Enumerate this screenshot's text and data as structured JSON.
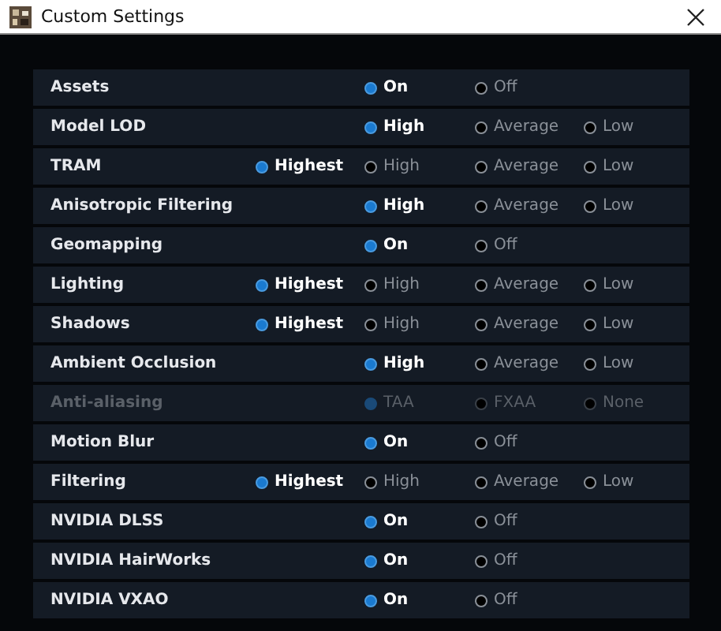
{
  "window": {
    "title": "Custom Settings"
  },
  "settings": [
    {
      "label": "Assets",
      "disabled": false,
      "options": [
        {
          "label": "On",
          "selected": true
        },
        {
          "label": "Off",
          "selected": false
        }
      ]
    },
    {
      "label": "Model LOD",
      "disabled": false,
      "options": [
        {
          "label": "High",
          "selected": true
        },
        {
          "label": "Average",
          "selected": false
        },
        {
          "label": "Low",
          "selected": false
        }
      ]
    },
    {
      "label": "TRAM",
      "disabled": false,
      "options": [
        {
          "label": "Highest",
          "selected": true
        },
        {
          "label": "High",
          "selected": false
        },
        {
          "label": "Average",
          "selected": false
        },
        {
          "label": "Low",
          "selected": false
        }
      ]
    },
    {
      "label": "Anisotropic Filtering",
      "disabled": false,
      "options": [
        {
          "label": "High",
          "selected": true
        },
        {
          "label": "Average",
          "selected": false
        },
        {
          "label": "Low",
          "selected": false
        }
      ]
    },
    {
      "label": "Geomapping",
      "disabled": false,
      "options": [
        {
          "label": "On",
          "selected": true
        },
        {
          "label": "Off",
          "selected": false
        }
      ]
    },
    {
      "label": "Lighting",
      "disabled": false,
      "options": [
        {
          "label": "Highest",
          "selected": true
        },
        {
          "label": "High",
          "selected": false
        },
        {
          "label": "Average",
          "selected": false
        },
        {
          "label": "Low",
          "selected": false
        }
      ]
    },
    {
      "label": "Shadows",
      "disabled": false,
      "options": [
        {
          "label": "Highest",
          "selected": true
        },
        {
          "label": "High",
          "selected": false
        },
        {
          "label": "Average",
          "selected": false
        },
        {
          "label": "Low",
          "selected": false
        }
      ]
    },
    {
      "label": "Ambient Occlusion",
      "disabled": false,
      "options": [
        {
          "label": "High",
          "selected": true
        },
        {
          "label": "Average",
          "selected": false
        },
        {
          "label": "Low",
          "selected": false
        }
      ]
    },
    {
      "label": "Anti-aliasing",
      "disabled": true,
      "options": [
        {
          "label": "TAA",
          "selected": true
        },
        {
          "label": "FXAA",
          "selected": false
        },
        {
          "label": "None",
          "selected": false
        }
      ]
    },
    {
      "label": "Motion Blur",
      "disabled": false,
      "options": [
        {
          "label": "On",
          "selected": true
        },
        {
          "label": "Off",
          "selected": false
        }
      ]
    },
    {
      "label": "Filtering",
      "disabled": false,
      "options": [
        {
          "label": "Highest",
          "selected": true
        },
        {
          "label": "High",
          "selected": false
        },
        {
          "label": "Average",
          "selected": false
        },
        {
          "label": "Low",
          "selected": false
        }
      ]
    },
    {
      "label": "NVIDIA DLSS",
      "disabled": false,
      "options": [
        {
          "label": "On",
          "selected": true
        },
        {
          "label": "Off",
          "selected": false
        }
      ]
    },
    {
      "label": "NVIDIA HairWorks",
      "disabled": false,
      "options": [
        {
          "label": "On",
          "selected": true
        },
        {
          "label": "Off",
          "selected": false
        }
      ]
    },
    {
      "label": "NVIDIA VXAO",
      "disabled": false,
      "options": [
        {
          "label": "On",
          "selected": true
        },
        {
          "label": "Off",
          "selected": false
        }
      ]
    }
  ]
}
